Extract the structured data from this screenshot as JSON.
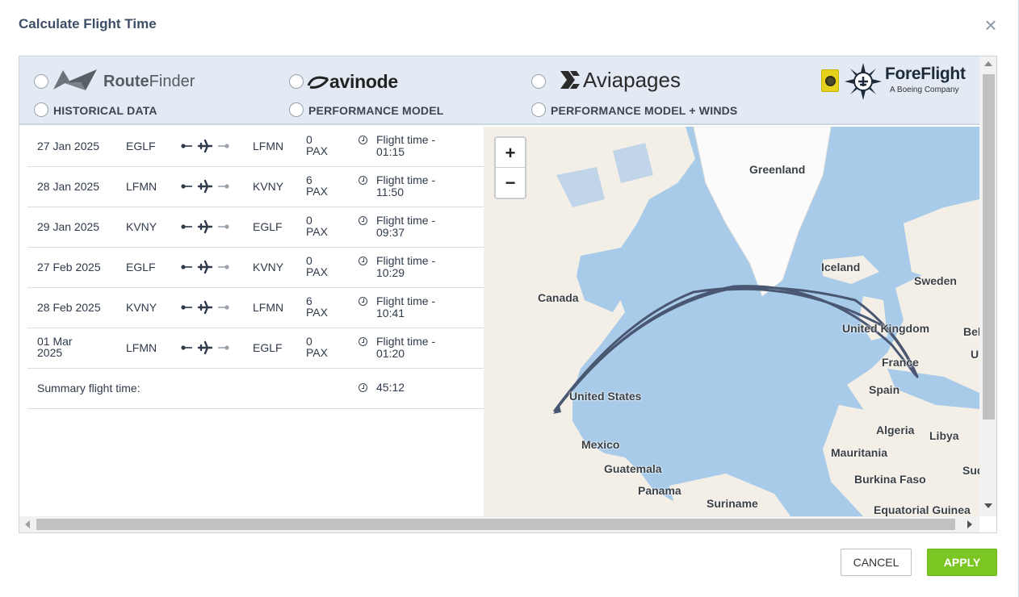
{
  "dialog": {
    "title": "Calculate Flight Time",
    "close_icon": "close-icon"
  },
  "providers": [
    {
      "name": "RouteFinder",
      "name_bold": "Route",
      "name_rest": "Finder",
      "option": "HISTORICAL DATA",
      "selected": false
    },
    {
      "name": "avinode",
      "option": "PERFORMANCE MODEL",
      "selected": false
    },
    {
      "name": "Aviapages",
      "option": "PERFORMANCE MODEL + WINDS",
      "selected": false
    },
    {
      "name": "ForeFlight",
      "subtitle": "A Boeing Company",
      "selected": true
    }
  ],
  "flights": [
    {
      "date": "27 Jan 2025",
      "from": "EGLF",
      "to": "LFMN",
      "pax": "0",
      "pax_unit": "PAX",
      "time_label": "Flight time -",
      "time": "01:15"
    },
    {
      "date": "28 Jan 2025",
      "from": "LFMN",
      "to": "KVNY",
      "pax": "6",
      "pax_unit": "PAX",
      "time_label": "Flight time -",
      "time": "11:50"
    },
    {
      "date": "29 Jan 2025",
      "from": "KVNY",
      "to": "EGLF",
      "pax": "0",
      "pax_unit": "PAX",
      "time_label": "Flight time -",
      "time": "09:37"
    },
    {
      "date": "27 Feb 2025",
      "from": "EGLF",
      "to": "KVNY",
      "pax": "0",
      "pax_unit": "PAX",
      "time_label": "Flight time -",
      "time": "10:29"
    },
    {
      "date": "28 Feb 2025",
      "from": "KVNY",
      "to": "LFMN",
      "pax": "6",
      "pax_unit": "PAX",
      "time_label": "Flight time -",
      "time": "10:41"
    },
    {
      "date": "01 Mar",
      "date2": "2025",
      "from": "LFMN",
      "to": "EGLF",
      "pax": "0",
      "pax_unit": "PAX",
      "time_label": "Flight time -",
      "time": "01:20"
    }
  ],
  "summary": {
    "label": "Summary flight time:",
    "time": "45:12"
  },
  "map": {
    "zoom_in": "+",
    "zoom_out": "−",
    "labels": [
      "Greenland",
      "Iceland",
      "Sweden",
      "Canada",
      "United Kingdom",
      "Bela",
      "Ukr",
      "France",
      "Spain",
      "United States",
      "Algeria",
      "Libya",
      "Mexico",
      "Mauritania",
      "Sud",
      "Guatemala",
      "Burkina Faso",
      "Panama",
      "Suriname",
      "Equatorial Guinea"
    ],
    "colors": {
      "water": "#a9cbea",
      "land": "#f4efe6",
      "ice": "#fafafa",
      "route": "#4a5772"
    }
  },
  "buttons": {
    "cancel": "CANCEL",
    "apply": "APPLY"
  },
  "colors": {
    "accent": "#7cc623",
    "provider_bg": "#e3eaf3",
    "title": "#3d4f66"
  }
}
